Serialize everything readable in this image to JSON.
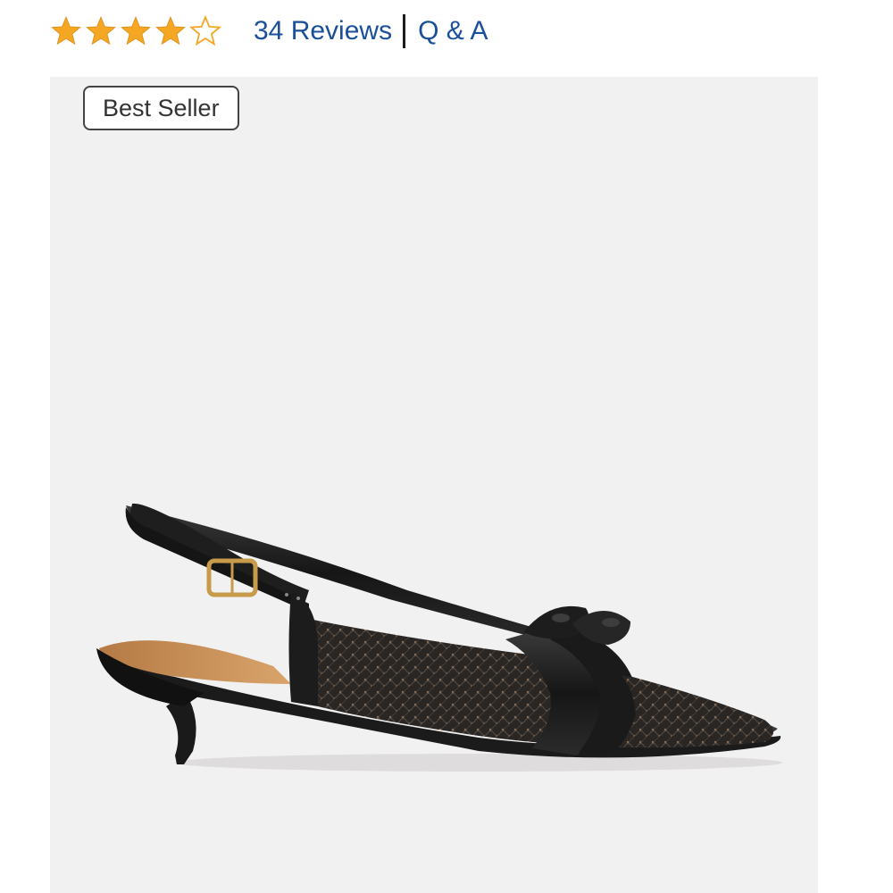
{
  "rating": {
    "stars": 4,
    "max_stars": 5,
    "star_color": "#f5a623",
    "reviews_label": "34 Reviews",
    "qa_label": "Q & A",
    "link_color": "#1a4f99"
  },
  "product": {
    "badge": "Best Seller",
    "image_description": "black lace slingback kitten heel"
  }
}
